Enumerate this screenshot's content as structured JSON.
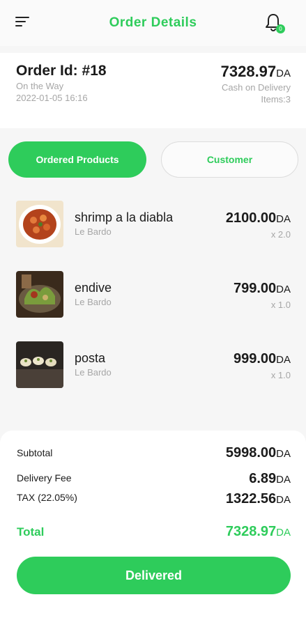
{
  "header": {
    "title": "Order Details",
    "notification_count": "0"
  },
  "order": {
    "id_label": "Order Id: #18",
    "status": "On the Way",
    "datetime": "2022-01-05 16:16",
    "amount": "7328.97",
    "currency": "DA",
    "payment_method": "Cash on Delivery",
    "items": "Items:3"
  },
  "tabs": [
    {
      "label": "Ordered Products",
      "active": true
    },
    {
      "label": "Customer",
      "active": false
    }
  ],
  "products": [
    {
      "name": "shrimp a la diabla",
      "store": "Le Bardo",
      "price": "2100.00",
      "currency": "DA",
      "qty": "x 2.0"
    },
    {
      "name": "endive",
      "store": "Le Bardo",
      "price": "799.00",
      "currency": "DA",
      "qty": "x 1.0"
    },
    {
      "name": "posta",
      "store": "Le Bardo",
      "price": "999.00",
      "currency": "DA",
      "qty": "x 1.0"
    }
  ],
  "summary": {
    "subtotal_label": "Subtotal",
    "subtotal_value": "5998.00",
    "delivery_label": "Delivery Fee",
    "delivery_value": "6.89",
    "tax_label": "TAX (22.05%)",
    "tax_value": "1322.56",
    "total_label": "Total",
    "total_value": "7328.97",
    "currency": "DA"
  },
  "action_button": "Delivered",
  "colors": {
    "accent": "#2ecc5b",
    "muted_text": "#a6a6a6"
  }
}
